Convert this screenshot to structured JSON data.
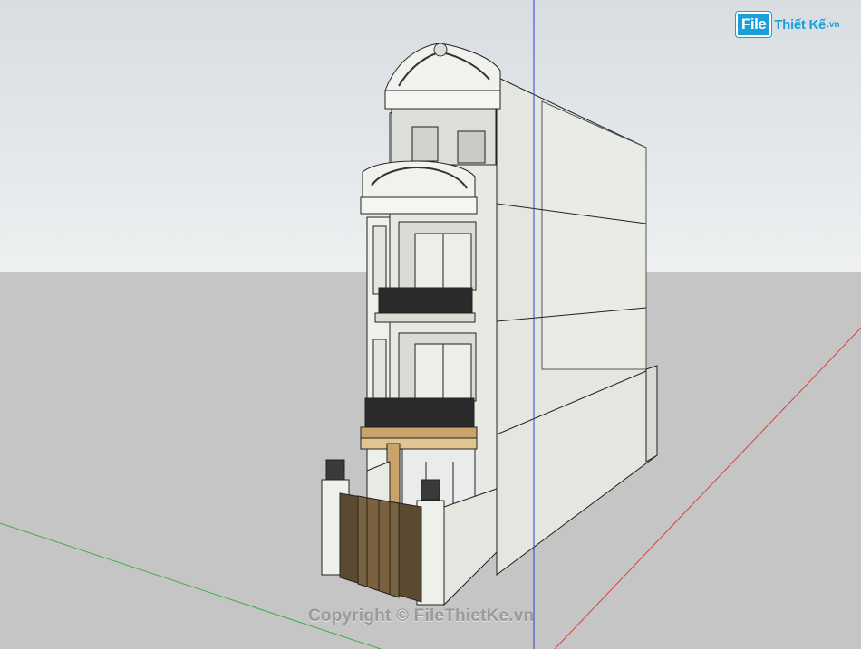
{
  "watermark": {
    "logo_file": "File",
    "logo_rest": "Thiết Kế",
    "logo_domain": ".vn",
    "copyright": "Copyright © FileThietKe.vn"
  },
  "colors": {
    "sky_top": "#d7dde1",
    "ground": "#c5c5c5",
    "wall": "#e6e9e2",
    "side_wall": "#dfe2db",
    "axis_red": "#d9403a",
    "axis_green": "#3fae45",
    "axis_blue": "#3040d0",
    "brand": "#1a9fd8"
  },
  "scene": {
    "model": "townhouse-facade",
    "axes": [
      "red-axis",
      "green-axis",
      "blue-axis"
    ]
  }
}
